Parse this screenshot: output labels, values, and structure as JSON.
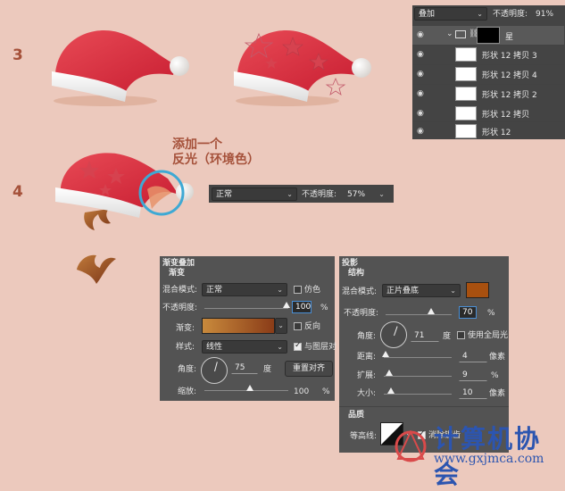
{
  "steps": {
    "step3": "3",
    "step4": "4"
  },
  "annotation": {
    "line1": "添加一个",
    "line2": "反光（环境色）"
  },
  "layers_panel": {
    "blend_mode": "叠加",
    "opacity_label": "不透明度:",
    "opacity_value": "91%",
    "group_name": "星",
    "layers": [
      "形状 12 拷贝 3",
      "形状 12 拷贝 4",
      "形状 12 拷贝 2",
      "形状 12 拷贝",
      "形状 12"
    ]
  },
  "mini_blend": {
    "mode": "正常",
    "opacity_label": "不透明度:",
    "opacity_value": "57%"
  },
  "gradient_overlay": {
    "title": "渐变叠加",
    "section": "渐变",
    "blend_label": "混合模式:",
    "blend_value": "正常",
    "dither_label": "仿色",
    "opacity_label": "不透明度:",
    "opacity_value": "100",
    "opacity_unit": "%",
    "opacity_fraction": 1.0,
    "gradient_label": "渐变:",
    "reverse_label": "反向",
    "style_label": "样式:",
    "style_value": "线性",
    "align_label": "与图层对",
    "angle_label": "角度:",
    "angle_value": "75",
    "angle_unit": "度",
    "reset_button": "重置对齐",
    "scale_label": "缩放:",
    "scale_value": "100",
    "scale_unit": "%",
    "gradient_colors": [
      "#c98a3c",
      "#8a3c18"
    ]
  },
  "drop_shadow": {
    "title": "投影",
    "section": "结构",
    "blend_label": "混合模式:",
    "blend_value": "正片叠底",
    "color": "#a8500f",
    "opacity_label": "不透明度:",
    "opacity_value": "70",
    "opacity_unit": "%",
    "angle_label": "角度:",
    "angle_value": "71",
    "angle_unit": "度",
    "global_light_label": "使用全局光",
    "distance_label": "距离:",
    "distance_value": "4",
    "distance_unit": "像素",
    "spread_label": "扩展:",
    "spread_value": "9",
    "spread_unit": "%",
    "size_label": "大小:",
    "size_value": "10",
    "size_unit": "像素",
    "quality_title": "品质",
    "contour_label": "等高线:",
    "antialias_label": "消除锯齿"
  },
  "watermark": {
    "text": "计算机协会",
    "url": "www.gxjmca.com"
  }
}
